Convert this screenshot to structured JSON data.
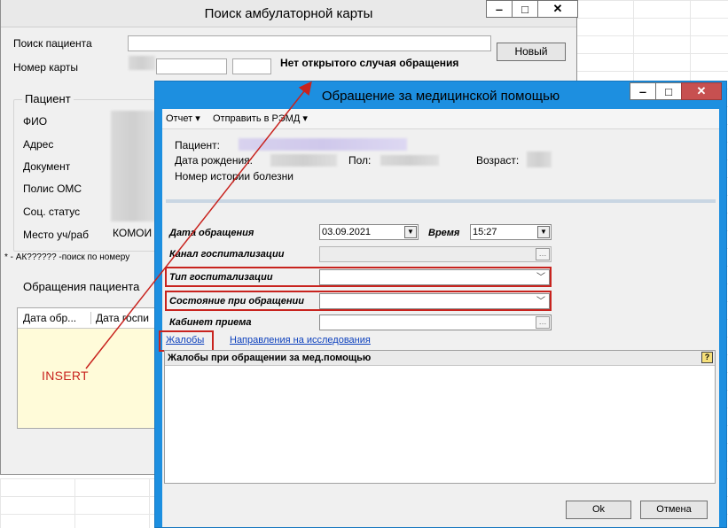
{
  "back_window": {
    "title": "Поиск амбулаторной карты",
    "search_label": "Поиск пациента",
    "card_label": "Номер карты",
    "new_button": "Новый",
    "no_case_text": "Нет открытого случая обращения",
    "patient_group": "Пациент",
    "fio_label": "ФИО",
    "address_label": "Адрес",
    "document_label": "Документ",
    "policy_label": "Полис ОМС",
    "social_label": "Соц. статус",
    "workplace_label": "Место уч/раб",
    "workplace_value_partial": "КОМОИ",
    "hint": "* - АК?????? -поиск по номеру",
    "visits_label": "Обращения пациента",
    "col_date": "Дата обр...",
    "col_date2": "Дата госпи"
  },
  "dialog": {
    "title": "Обращение за медицинской помощью",
    "menu": {
      "report": "Отчет",
      "send": "Отправить в РЭМД"
    },
    "patient_label": "Пациент:",
    "birth_label": "Дата рождения:",
    "sex_label": "Пол:",
    "age_label": "Возраст:",
    "history_label": "Номер истории болезни",
    "form": {
      "date_label": "Дата обращения",
      "date_value": "03.09.2021",
      "time_label": "Время",
      "time_value": "15:27",
      "channel_label": "Канал госпитализации",
      "hosp_type_label": "Тип госпитализации",
      "state_label": "Состояние при обращении",
      "cabinet_label": "Кабинет приема"
    },
    "tabs": {
      "complaints": "Жалобы",
      "directions": "Направления на исследования"
    },
    "panel_title": "Жалобы при обращении за мед.помощью",
    "ok_button": "Ok",
    "cancel_button": "Отмена"
  },
  "annotation": {
    "label": "INSERT",
    "color": "#c8231e"
  },
  "colors": {
    "dialog_border": "#1d8fe0",
    "highlight": "#c8231e",
    "link": "#0b3fbd"
  }
}
